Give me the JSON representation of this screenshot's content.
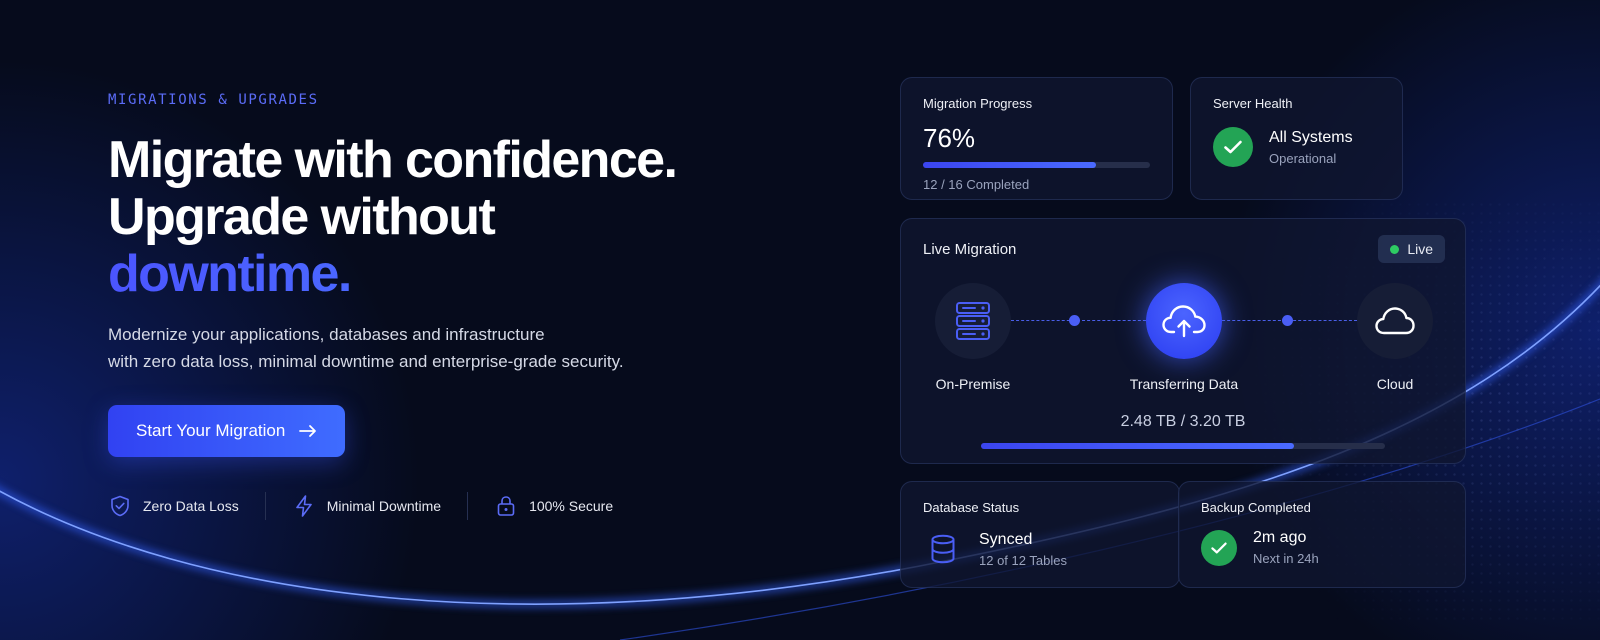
{
  "colors": {
    "background": "#060b1c",
    "accent": "#4a5ef5",
    "success": "#23a455",
    "live": "#2ecc63"
  },
  "hero": {
    "eyebrow": "MIGRATIONS & UPGRADES",
    "headline_line1": "Migrate with confidence.",
    "headline_line2": "Upgrade without",
    "headline_accent": "downtime.",
    "description_line1": "Modernize your applications, databases and infrastructure",
    "description_line2": "with zero data loss, minimal downtime and enterprise-grade security.",
    "cta_label": "Start Your Migration",
    "cta_icon": "arrow-right-icon",
    "features": [
      {
        "label": "Zero Data Loss",
        "icon": "shield-check-icon"
      },
      {
        "label": "Minimal Downtime",
        "icon": "lightning-icon"
      },
      {
        "label": "100% Secure",
        "icon": "lock-icon"
      }
    ]
  },
  "migration_progress": {
    "title": "Migration Progress",
    "percent_text": "76%",
    "progress_fraction": 0.76,
    "completed_text": "12 / 16 Completed"
  },
  "server_health": {
    "title": "Server Health",
    "status": "All Systems",
    "substatus": "Operational",
    "icon": "check-icon"
  },
  "live_migration": {
    "title": "Live Migration",
    "badge": "Live",
    "nodes": [
      {
        "label": "On-Premise",
        "icon": "server-icon"
      },
      {
        "label": "Transferring Data",
        "icon": "cloud-upload-icon"
      },
      {
        "label": "Cloud",
        "icon": "cloud-icon"
      }
    ],
    "transfer_text": "2.48 TB / 3.20 TB",
    "transfer_fraction": 0.775
  },
  "database_status": {
    "title": "Database Status",
    "status": "Synced",
    "detail": "12 of 12 Tables",
    "icon": "database-icon"
  },
  "backup": {
    "title": "Backup Completed",
    "status": "2m ago",
    "detail": "Next in 24h",
    "icon": "check-icon"
  }
}
